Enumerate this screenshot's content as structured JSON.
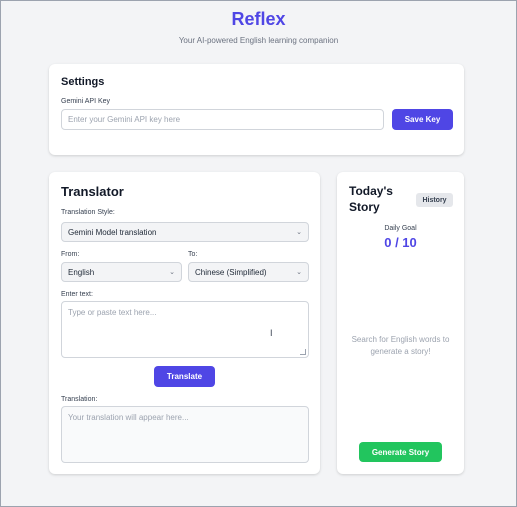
{
  "header": {
    "title": "Reflex",
    "subtitle": "Your AI-powered English learning companion"
  },
  "settings": {
    "title": "Settings",
    "api_label": "Gemini API Key",
    "api_placeholder": "Enter your Gemini API key here",
    "save_label": "Save Key"
  },
  "translator": {
    "title": "Translator",
    "style_label": "Translation Style:",
    "style_value": "Gemini Model translation",
    "from_label": "From:",
    "from_value": "English",
    "to_label": "To:",
    "to_value": "Chinese (Simplified)",
    "input_label": "Enter text:",
    "input_placeholder": "Type or paste text here...",
    "translate_label": "Translate",
    "output_label": "Translation:",
    "output_placeholder": "Your translation will appear here..."
  },
  "story": {
    "title": "Today's Story",
    "history_label": "History",
    "goal_label": "Daily Goal",
    "goal_value": "0 / 10",
    "hint": "Search for English words to generate a story!",
    "generate_label": "Generate Story"
  },
  "colors": {
    "accent": "#4f46e5",
    "success": "#22c55e",
    "background": "#f3f4f6"
  },
  "icons": [
    "chevron-down-icon",
    "text-cursor-icon",
    "resize-handle-icon"
  ]
}
